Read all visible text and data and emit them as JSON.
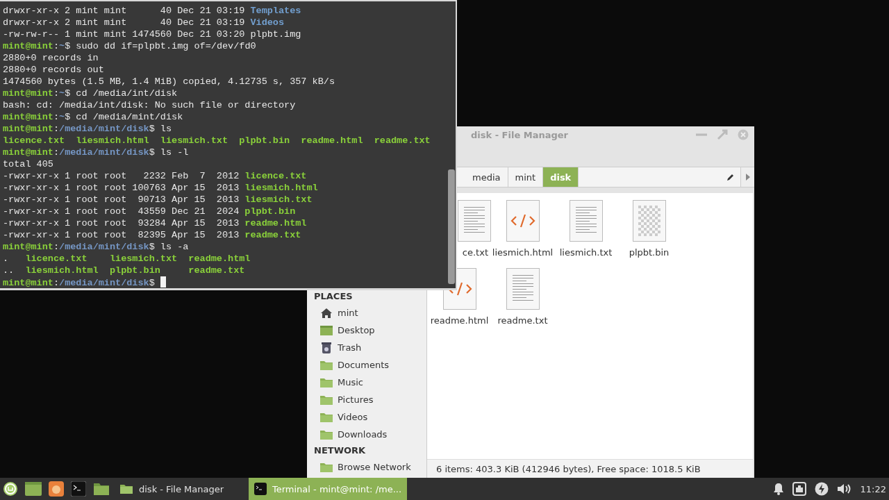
{
  "terminal": {
    "cursor": true,
    "lines": [
      {
        "segments": [
          {
            "text": "drwxr-xr-x 2 mint mint      40 Dec 21 03:19 ",
            "kind": "plain"
          },
          {
            "text": "Templates",
            "kind": "dir"
          }
        ]
      },
      {
        "segments": [
          {
            "text": "drwxr-xr-x 2 mint mint      40 Dec 21 03:19 ",
            "kind": "plain"
          },
          {
            "text": "Videos",
            "kind": "dir"
          }
        ]
      },
      {
        "segments": [
          {
            "text": "-rw-rw-r-- 1 mint mint 1474560 Dec 21 03:20 plpbt.img",
            "kind": "plain"
          }
        ]
      },
      {
        "segments": [
          {
            "text": "mint@mint",
            "kind": "user"
          },
          {
            "text": ":",
            "kind": "plain"
          },
          {
            "text": "~",
            "kind": "path"
          },
          {
            "text": "$ sudo dd if=plpbt.img of=/dev/fd0",
            "kind": "plain"
          }
        ]
      },
      {
        "segments": [
          {
            "text": "2880+0 records in",
            "kind": "plain"
          }
        ]
      },
      {
        "segments": [
          {
            "text": "2880+0 records out",
            "kind": "plain"
          }
        ]
      },
      {
        "segments": [
          {
            "text": "1474560 bytes (1.5 MB, 1.4 MiB) copied, 4.12735 s, 357 kB/s",
            "kind": "plain"
          }
        ]
      },
      {
        "segments": [
          {
            "text": "mint@mint",
            "kind": "user"
          },
          {
            "text": ":",
            "kind": "plain"
          },
          {
            "text": "~",
            "kind": "path"
          },
          {
            "text": "$ cd /media/int/disk",
            "kind": "plain"
          }
        ]
      },
      {
        "segments": [
          {
            "text": "bash: cd: /media/int/disk: No such file or directory",
            "kind": "plain"
          }
        ]
      },
      {
        "segments": [
          {
            "text": "mint@mint",
            "kind": "user"
          },
          {
            "text": ":",
            "kind": "plain"
          },
          {
            "text": "~",
            "kind": "path"
          },
          {
            "text": "$ cd /media/mint/disk",
            "kind": "plain"
          }
        ]
      },
      {
        "segments": [
          {
            "text": "mint@mint",
            "kind": "user"
          },
          {
            "text": ":",
            "kind": "plain"
          },
          {
            "text": "/media/mint/disk",
            "kind": "path"
          },
          {
            "text": "$ ls",
            "kind": "plain"
          }
        ]
      },
      {
        "segments": [
          {
            "text": "licence.txt  liesmich.html  liesmich.txt  plpbt.bin  readme.html  readme.txt",
            "kind": "exec"
          }
        ]
      },
      {
        "segments": [
          {
            "text": "mint@mint",
            "kind": "user"
          },
          {
            "text": ":",
            "kind": "plain"
          },
          {
            "text": "/media/mint/disk",
            "kind": "path"
          },
          {
            "text": "$ ls -l",
            "kind": "plain"
          }
        ]
      },
      {
        "segments": [
          {
            "text": "total 405",
            "kind": "plain"
          }
        ]
      },
      {
        "segments": [
          {
            "text": "-rwxr-xr-x 1 root root   2232 Feb  7  2012 ",
            "kind": "plain"
          },
          {
            "text": "licence.txt",
            "kind": "exec"
          }
        ]
      },
      {
        "segments": [
          {
            "text": "-rwxr-xr-x 1 root root 100763 Apr 15  2013 ",
            "kind": "plain"
          },
          {
            "text": "liesmich.html",
            "kind": "exec"
          }
        ]
      },
      {
        "segments": [
          {
            "text": "-rwxr-xr-x 1 root root  90713 Apr 15  2013 ",
            "kind": "plain"
          },
          {
            "text": "liesmich.txt",
            "kind": "exec"
          }
        ]
      },
      {
        "segments": [
          {
            "text": "-rwxr-xr-x 1 root root  43559 Dec 21  2024 ",
            "kind": "plain"
          },
          {
            "text": "plpbt.bin",
            "kind": "exec"
          }
        ]
      },
      {
        "segments": [
          {
            "text": "-rwxr-xr-x 1 root root  93284 Apr 15  2013 ",
            "kind": "plain"
          },
          {
            "text": "readme.html",
            "kind": "exec"
          }
        ]
      },
      {
        "segments": [
          {
            "text": "-rwxr-xr-x 1 root root  82395 Apr 15  2013 ",
            "kind": "plain"
          },
          {
            "text": "readme.txt",
            "kind": "exec"
          }
        ]
      },
      {
        "segments": [
          {
            "text": "mint@mint",
            "kind": "user"
          },
          {
            "text": ":",
            "kind": "plain"
          },
          {
            "text": "/media/mint/disk",
            "kind": "path"
          },
          {
            "text": "$ ls -a",
            "kind": "plain"
          }
        ]
      },
      {
        "segments": [
          {
            "text": ".   ",
            "kind": "plain"
          },
          {
            "text": "licence.txt    liesmich.txt  readme.html",
            "kind": "exec"
          }
        ]
      },
      {
        "segments": [
          {
            "text": "..  ",
            "kind": "plain"
          },
          {
            "text": "liesmich.html  plpbt.bin     readme.txt",
            "kind": "exec"
          }
        ]
      },
      {
        "segments": [
          {
            "text": "mint@mint",
            "kind": "user"
          },
          {
            "text": ":",
            "kind": "plain"
          },
          {
            "text": "/media/mint/disk",
            "kind": "path"
          },
          {
            "text": "$ ",
            "kind": "plain"
          }
        ]
      }
    ]
  },
  "file_manager": {
    "title": "disk - File Manager",
    "breadcrumbs": [
      {
        "label": "media",
        "selected": false
      },
      {
        "label": "mint",
        "selected": false
      },
      {
        "label": "disk",
        "selected": true
      }
    ],
    "sidebar": [
      {
        "heading": "PLACES",
        "items": [
          {
            "label": "mint",
            "kind": "home"
          },
          {
            "label": "Desktop",
            "kind": "desktop"
          },
          {
            "label": "Trash",
            "kind": "trash"
          },
          {
            "label": "Documents",
            "kind": "folder"
          },
          {
            "label": "Music",
            "kind": "folder"
          },
          {
            "label": "Pictures",
            "kind": "folder"
          },
          {
            "label": "Videos",
            "kind": "folder"
          },
          {
            "label": "Downloads",
            "kind": "folder"
          }
        ]
      },
      {
        "heading": "NETWORK",
        "items": [
          {
            "label": "Browse Network",
            "kind": "folder"
          }
        ]
      }
    ],
    "files": [
      {
        "label": "ce.txt",
        "kind": "text"
      },
      {
        "label": "liesmich.html",
        "kind": "html"
      },
      {
        "label": "liesmich.txt",
        "kind": "text"
      },
      {
        "label": "plpbt.bin",
        "kind": "binary"
      },
      {
        "label": "readme.html",
        "kind": "html"
      },
      {
        "label": "readme.txt",
        "kind": "text"
      }
    ],
    "status": "6 items: 403.3 KiB (412946 bytes), Free space: 1018.5 KiB"
  },
  "taskbar": {
    "windows": [
      {
        "label": "disk - File Manager",
        "kind": "folder",
        "selected": false
      },
      {
        "label": "Terminal - mint@mint: /me...",
        "kind": "terminal",
        "selected": true
      }
    ],
    "clock": "11:22"
  }
}
